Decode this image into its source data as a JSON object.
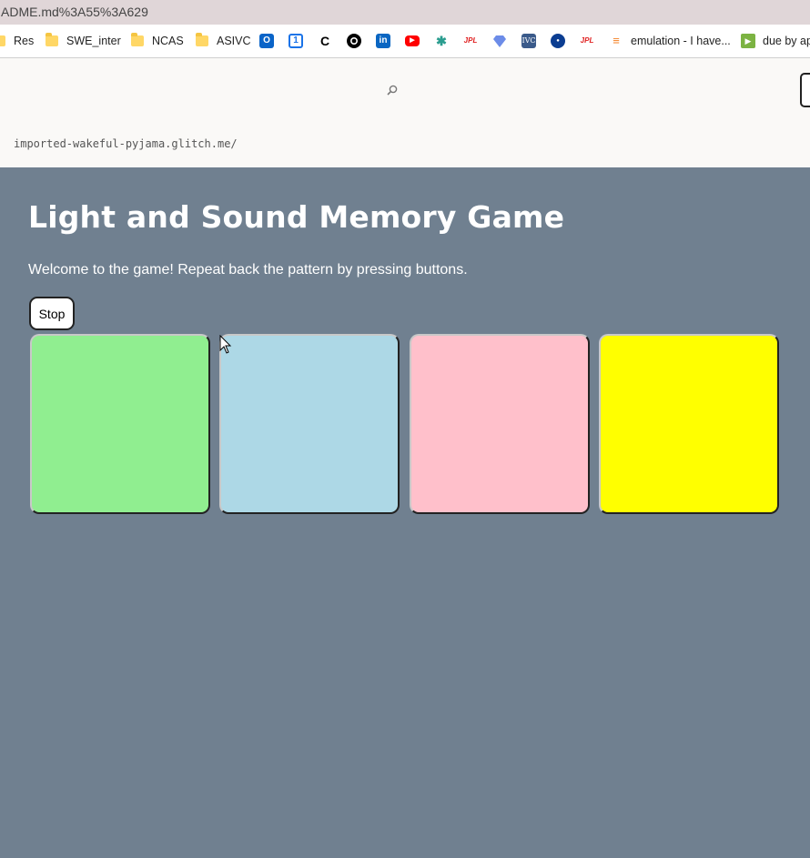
{
  "browser": {
    "url_text": "ADME.md%3A55%3A629",
    "bookmarks": [
      {
        "label": "Res",
        "kind": "folder"
      },
      {
        "label": "SWE_inter",
        "kind": "folder"
      },
      {
        "label": "NCAS",
        "kind": "folder"
      },
      {
        "label": "ASIVC",
        "kind": "folder"
      },
      {
        "label": "emulation - I have...",
        "kind": "stackoverflow"
      },
      {
        "label": "due by ap",
        "kind": "play"
      }
    ],
    "bookmark_icons": [
      "outlook-icon",
      "calendar-icon",
      "c-icon",
      "github-icon",
      "linkedin-icon",
      "youtube-icon",
      "pinwheel-icon",
      "jpl-icon",
      "diamond-icon",
      "ivc-icon",
      "nasa-icon",
      "jpl-icon"
    ],
    "calendar_number": "1",
    "jpl_label": "JPL",
    "ivc_label": "IVC"
  },
  "glitch": {
    "project_url": "imported-wakeful-pyjama.glitch.me/"
  },
  "game": {
    "title": "Light and Sound Memory Game",
    "welcome": "Welcome to the game! Repeat back the pattern by pressing buttons.",
    "stop_label": "Stop",
    "buttons": [
      {
        "color": "#90ee90",
        "name": "lightgreen"
      },
      {
        "color": "#add8e6",
        "name": "lightblue"
      },
      {
        "color": "#ffc0cb",
        "name": "pink"
      },
      {
        "color": "#ffff00",
        "name": "yellow"
      }
    ]
  },
  "colors": {
    "page_background": "#708090",
    "header_background": "#faf9f7"
  }
}
